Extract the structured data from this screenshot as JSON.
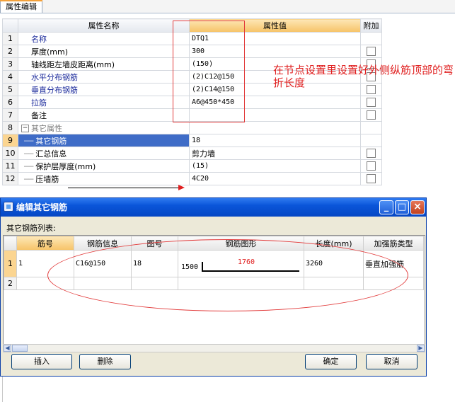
{
  "tab": {
    "label": "属性编辑"
  },
  "grid": {
    "headers": {
      "num": "",
      "name": "属性名称",
      "value": "属性值",
      "add": "附加"
    },
    "rows": [
      {
        "num": "1",
        "name": "名称",
        "value": "DTQ1"
      },
      {
        "num": "2",
        "name": "厚度(mm)",
        "value": "300"
      },
      {
        "num": "3",
        "name": "轴线距左墙皮距离(mm)",
        "value": "(150)"
      },
      {
        "num": "4",
        "name": "水平分布钢筋",
        "value": "(2)C12@150"
      },
      {
        "num": "5",
        "name": "垂直分布钢筋",
        "value": "(2)C14@150"
      },
      {
        "num": "6",
        "name": "拉筋",
        "value": "A6@450*450"
      },
      {
        "num": "7",
        "name": "备注",
        "value": ""
      },
      {
        "num": "8",
        "name": "其它属性",
        "value": ""
      },
      {
        "num": "9",
        "name": "其它钢筋",
        "value": "18"
      },
      {
        "num": "10",
        "name": "汇总信息",
        "value": "剪力墙"
      },
      {
        "num": "11",
        "name": "保护层厚度(mm)",
        "value": "(15)"
      },
      {
        "num": "12",
        "name": "压墙筋",
        "value": "4C20"
      }
    ]
  },
  "annotation": {
    "note": "在节点设置里设置好外侧纵筋顶部的弯折长度"
  },
  "colors": {
    "annotation": "#e02020",
    "title_bar": "#0a55d9",
    "header_highlight": "#f6c367"
  },
  "dialog": {
    "title": "编辑其它钢筋",
    "list_label": "其它钢筋列表:",
    "titlebar_buttons": {
      "min": "_",
      "max": "□",
      "close": "×"
    },
    "columns": {
      "num": "",
      "bar_no": "筋号",
      "bar_info": "钢筋信息",
      "fig_no": "图号",
      "shape": "钢筋图形",
      "length": "长度(mm)",
      "type": "加强筋类型"
    },
    "rows": [
      {
        "num": "1",
        "bar_no": "1",
        "bar_info": "C16@150",
        "fig_no": "18",
        "shape_left": "1500",
        "shape_mid": "1760",
        "length": "3260",
        "type": "垂直加强筋"
      },
      {
        "num": "2",
        "bar_no": "",
        "bar_info": "",
        "fig_no": "",
        "shape_left": "",
        "shape_mid": "",
        "length": "",
        "type": ""
      }
    ],
    "buttons": {
      "insert": "插入",
      "delete": "删除",
      "ok": "确定",
      "cancel": "取消"
    }
  }
}
